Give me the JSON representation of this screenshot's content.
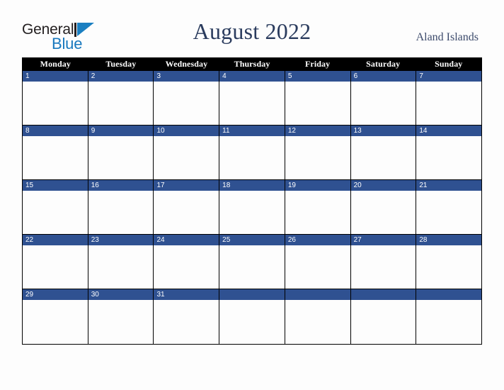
{
  "brand": {
    "name_part1": "General",
    "name_part2": "Blue",
    "mark_icon": "triangle-flag-icon",
    "color_dark": "#231f20",
    "color_blue": "#1878be"
  },
  "header": {
    "title": "August 2022",
    "region": "Aland Islands",
    "title_color": "#2b3c5e"
  },
  "calendar": {
    "day_headers": [
      "Monday",
      "Tuesday",
      "Wednesday",
      "Thursday",
      "Friday",
      "Saturday",
      "Sunday"
    ],
    "header_bg": "#000000",
    "header_fg": "#ffffff",
    "date_strip_bg": "#2f5191",
    "date_strip_fg": "#ffffff",
    "cell_bg": "#fdfdfd",
    "border_color": "#000000",
    "weeks": [
      [
        {
          "num": "1"
        },
        {
          "num": "2"
        },
        {
          "num": "3"
        },
        {
          "num": "4"
        },
        {
          "num": "5"
        },
        {
          "num": "6"
        },
        {
          "num": "7"
        }
      ],
      [
        {
          "num": "8"
        },
        {
          "num": "9"
        },
        {
          "num": "10"
        },
        {
          "num": "11"
        },
        {
          "num": "12"
        },
        {
          "num": "13"
        },
        {
          "num": "14"
        }
      ],
      [
        {
          "num": "15"
        },
        {
          "num": "16"
        },
        {
          "num": "17"
        },
        {
          "num": "18"
        },
        {
          "num": "19"
        },
        {
          "num": "20"
        },
        {
          "num": "21"
        }
      ],
      [
        {
          "num": "22"
        },
        {
          "num": "23"
        },
        {
          "num": "24"
        },
        {
          "num": "25"
        },
        {
          "num": "26"
        },
        {
          "num": "27"
        },
        {
          "num": "28"
        }
      ],
      [
        {
          "num": "29"
        },
        {
          "num": "30"
        },
        {
          "num": "31"
        },
        {
          "num": ""
        },
        {
          "num": ""
        },
        {
          "num": ""
        },
        {
          "num": ""
        }
      ]
    ]
  }
}
